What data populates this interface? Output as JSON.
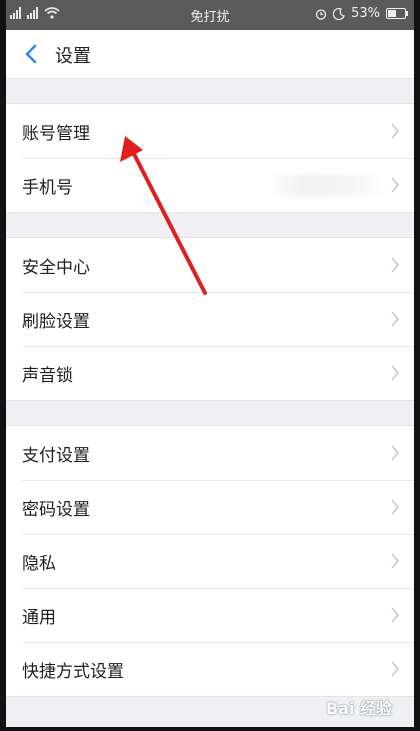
{
  "status_bar": {
    "center_text": "免打扰",
    "battery_text": "53%",
    "battery_level": 0.53
  },
  "nav": {
    "title": "设置",
    "back_icon": "chevron-left-icon"
  },
  "groups": [
    {
      "items": [
        {
          "label": "账号管理"
        },
        {
          "label": "手机号"
        }
      ]
    },
    {
      "items": [
        {
          "label": "安全中心"
        },
        {
          "label": "刷脸设置"
        },
        {
          "label": "声音锁"
        }
      ]
    },
    {
      "items": [
        {
          "label": "支付设置"
        },
        {
          "label": "密码设置"
        },
        {
          "label": "隐私"
        },
        {
          "label": "通用"
        },
        {
          "label": "快捷方式设置"
        }
      ]
    }
  ],
  "annotation": {
    "color": "#e02020"
  },
  "colors": {
    "accent": "#2d8cf0",
    "chevron": "#c7c7cc",
    "background": "#efeff4"
  },
  "watermark": {
    "text": "Bai 经验"
  }
}
